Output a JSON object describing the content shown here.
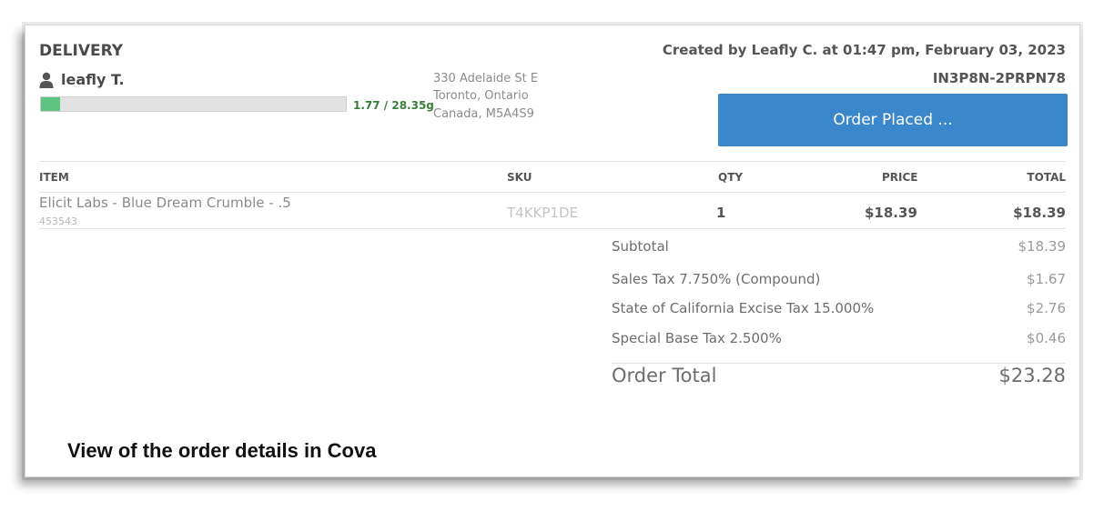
{
  "order": {
    "type_label": "DELIVERY",
    "customer": "leafly T.",
    "limit_text": "1.77 / 28.35g",
    "limit_fraction": 0.0624,
    "address": [
      "330 Adelaide St E",
      "Toronto, Ontario",
      "Canada, M5A4S9"
    ],
    "created": "Created by Leafly C. at 01:47 pm, February 03, 2023",
    "id": "IN3P8N-2PRPN78",
    "status_button": "Order Placed ...",
    "status_color": "#3a87cc",
    "progress_color": "#5ec482"
  },
  "table": {
    "headers": {
      "item": "ITEM",
      "sku": "SKU",
      "qty": "QTY",
      "price": "PRICE",
      "total": "TOTAL"
    },
    "rows": [
      {
        "name": "Elicit Labs - Blue Dream Crumble - .5",
        "code": "453543",
        "sku": "T4KKP1DE",
        "qty": "1",
        "price": "$18.39",
        "total": "$18.39"
      }
    ]
  },
  "summary": {
    "lines": [
      {
        "label": "Subtotal",
        "value": "$18.39"
      },
      {
        "label": "Sales Tax  7.750% (Compound)",
        "value": "$1.67"
      },
      {
        "label": "State of California Excise Tax  15.000%",
        "value": "$2.76"
      },
      {
        "label": "Special Base Tax  2.500%",
        "value": "$0.46"
      }
    ],
    "total_label": "Order Total",
    "total_value": "$23.28"
  },
  "caption": "View of the order details in Cova"
}
